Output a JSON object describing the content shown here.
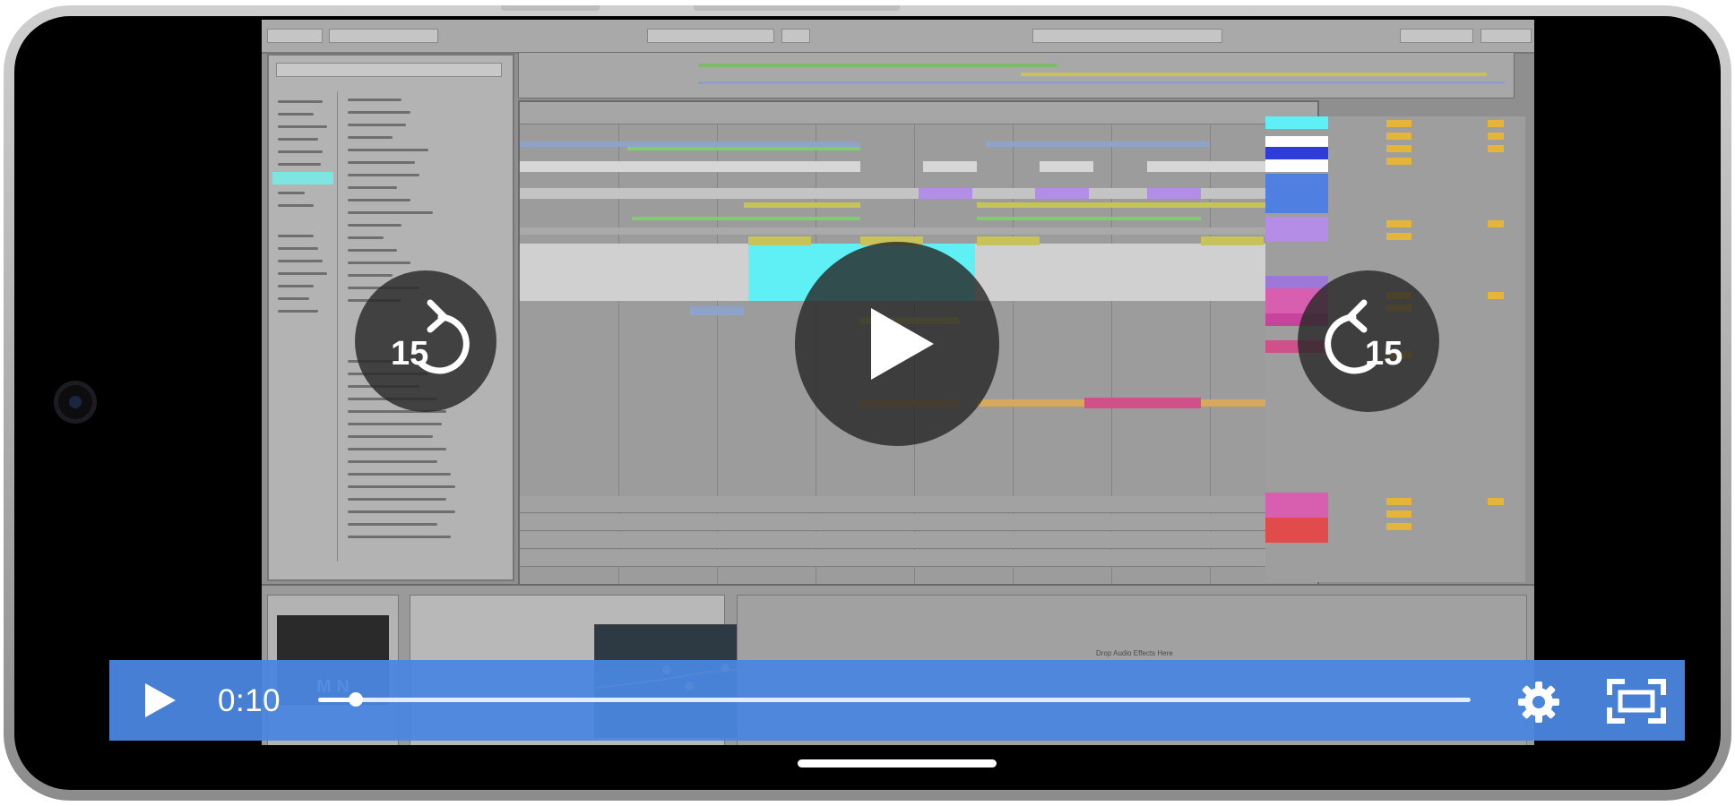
{
  "player": {
    "elapsed_time": "0:10",
    "progress_fraction": 0.033,
    "seek_back_seconds": "15",
    "seek_forward_seconds": "15"
  },
  "device_panel": {
    "logo_text": "M  N",
    "drop_hint": "Drop Audio Effects Here"
  },
  "colors": {
    "control_bar": "#4a86df",
    "overlay_button": "#282828",
    "accent_cyan": "#5ff0f5"
  },
  "icons": [
    "play-icon",
    "replay-15-icon",
    "forward-15-icon",
    "settings-gear-icon",
    "fullscreen-icon"
  ]
}
